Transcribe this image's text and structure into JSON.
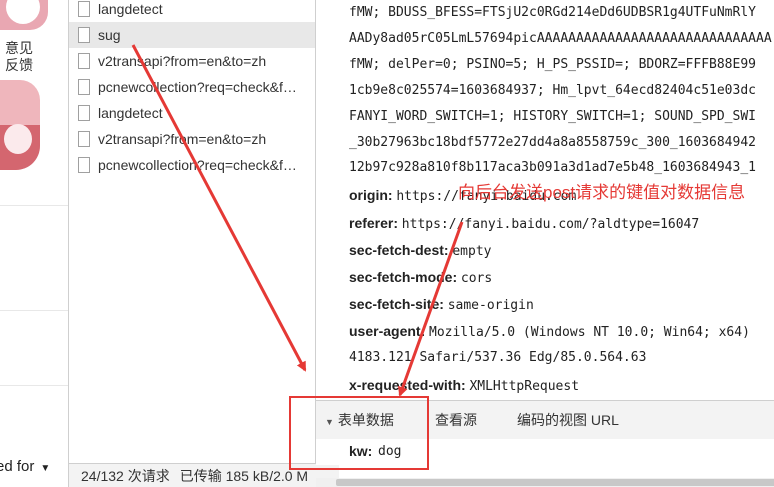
{
  "left_page": {
    "feedback_label": "意见反馈",
    "bottom_text": "ed for",
    "bottom_arrow": "▼"
  },
  "requests": [
    {
      "name": "langdetect",
      "selected": false
    },
    {
      "name": "sug",
      "selected": true
    },
    {
      "name": "v2transapi?from=en&to=zh",
      "selected": false
    },
    {
      "name": "pcnewcollection?req=check&f…",
      "selected": false
    },
    {
      "name": "langdetect",
      "selected": false
    },
    {
      "name": "v2transapi?from=en&to=zh",
      "selected": false
    },
    {
      "name": "pcnewcollection?req=check&f…",
      "selected": false
    }
  ],
  "status_bar": {
    "requests": "24/132 次请求",
    "transferred": "已传输 185 kB/2.0 M"
  },
  "headers": {
    "cookie_lines": [
      "fMW; BDUSS_BFESS=FTSjU2c0RGd214eDd6UDBSR1g4UTFuNmRlY",
      "AADy8ad05rC05LmL57694picAAAAAAAAAAAAAAAAAAAAAAAAAAAAAA",
      "fMW; delPer=0; PSINO=5; H_PS_PSSID=; BDORZ=FFFB88E99",
      "1cb9e8c025574=1603684937; Hm_lpvt_64ecd82404c51e03dc",
      "FANYI_WORD_SWITCH=1; HISTORY_SWITCH=1; SOUND_SPD_SWI",
      "_30b27963bc18bdf5772e27dd4a8a8558759c_300_1603684942",
      "12b97c928a810f8b117aca3b091a3d1ad7e5b48_1603684943_1"
    ],
    "origin_key": "origin:",
    "origin_value": "https://fanyi.baidu.com",
    "referer_key": "referer:",
    "referer_value": "https://fanyi.baidu.com/?aldtype=16047",
    "sec_fetch_dest_key": "sec-fetch-dest:",
    "sec_fetch_dest_value": "empty",
    "sec_fetch_mode_key": "sec-fetch-mode:",
    "sec_fetch_mode_value": "cors",
    "sec_fetch_site_key": "sec-fetch-site:",
    "sec_fetch_site_value": "same-origin",
    "user_agent_key": "user-agent:",
    "user_agent_value": "Mozilla/5.0 (Windows NT 10.0; Win64; x64)",
    "user_agent_cont": "4183.121 Safari/537.36 Edg/85.0.564.63",
    "x_requested_with_key": "x-requested-with:",
    "x_requested_with_value": "XMLHttpRequest"
  },
  "tabs": {
    "form_data": "表单数据",
    "view_source": "查看源",
    "view_url_encoded": "编码的视图 URL"
  },
  "form_data": {
    "key": "kw:",
    "value": "dog"
  },
  "annotation": {
    "text": "向后台发送post请求的键值对数据信息",
    "color": "#e53935"
  }
}
